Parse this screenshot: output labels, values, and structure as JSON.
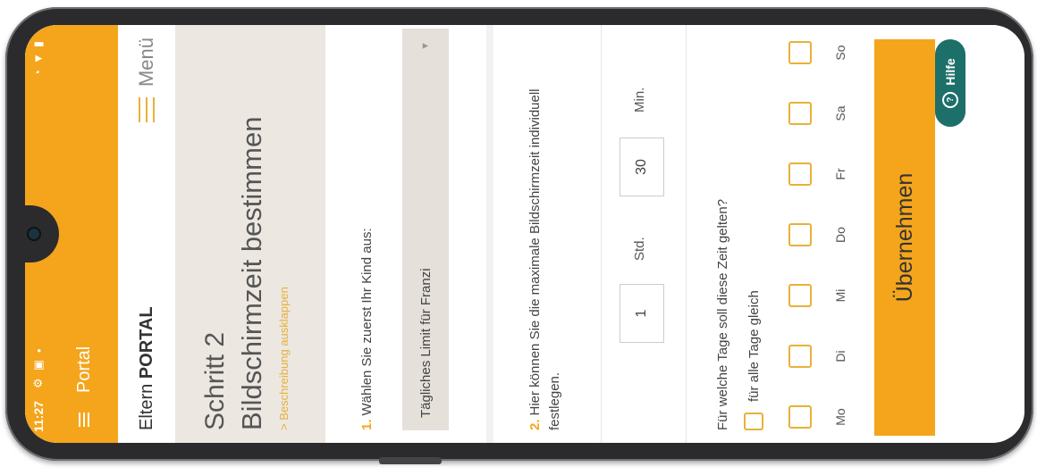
{
  "status": {
    "time": "11:27",
    "icons": [
      "settings-icon",
      "image-icon",
      "dot-icon"
    ],
    "right_icons": [
      "signal-icon",
      "wifi-icon",
      "battery-icon"
    ]
  },
  "nav": {
    "title": "Portal"
  },
  "portal": {
    "brand_prefix": "Eltern ",
    "brand_bold": "PORTAL",
    "menu_label": "Menü"
  },
  "step": {
    "label": "Schritt 2",
    "title": "Bildschirmzeit bestimmen",
    "toggle": "> Beschreibung ausklappen"
  },
  "section1": {
    "num": "1.",
    "question": "Wählen Sie zuerst Ihr Kind aus:",
    "select_value": "Tägliches Limit für Franzi"
  },
  "section2": {
    "num": "2.",
    "question": "Hier können Sie die maximale Bildschirmzeit individuell festlegen.",
    "hours_value": "1",
    "hours_unit": "Std.",
    "minutes_value": "30",
    "minutes_unit": "Min."
  },
  "section3": {
    "question": "Für welche Tage soll diese Zeit gelten?",
    "all_days_label": "für alle Tage gleich",
    "days": [
      "Mo",
      "Di",
      "Mi",
      "Do",
      "Fr",
      "Sa",
      "So"
    ]
  },
  "apply_label": "Übernehmen",
  "help_label": "Hilfe",
  "colors": {
    "accent": "#f4a51b",
    "help": "#1d6f6a",
    "header_bg": "#ece7e1"
  }
}
